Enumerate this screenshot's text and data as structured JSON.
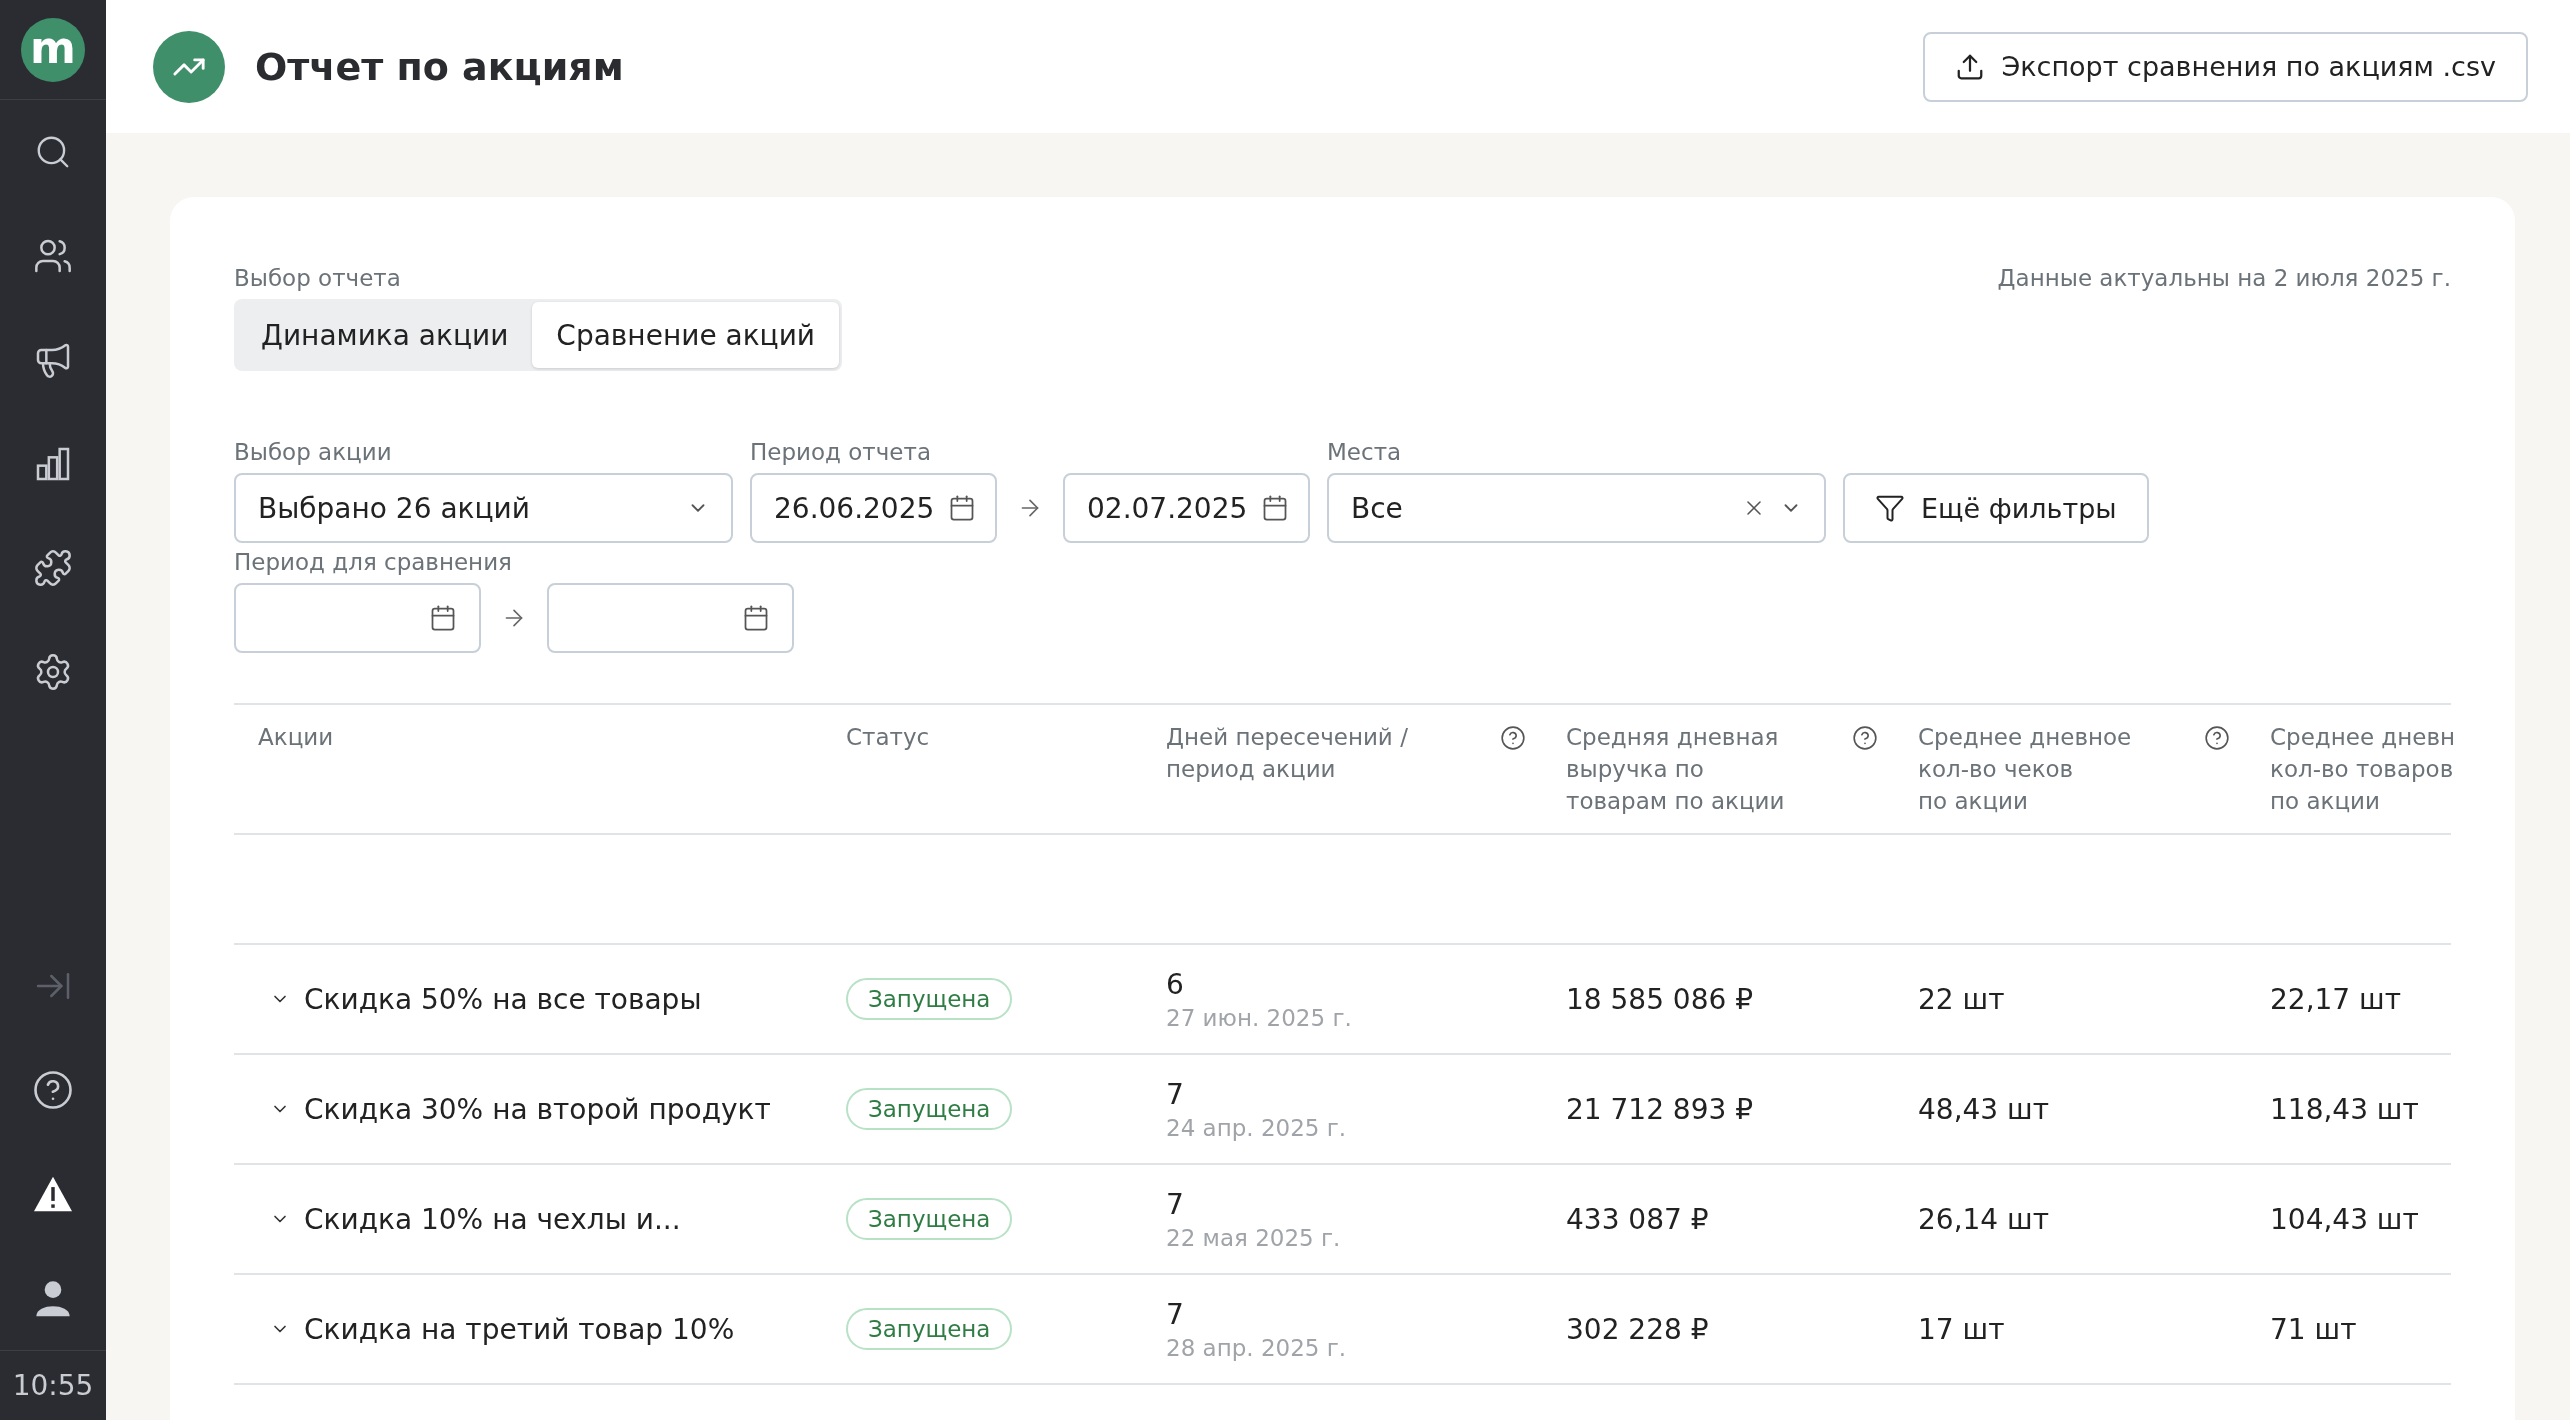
{
  "sidebar": {
    "logo": "m",
    "time": "10:55"
  },
  "header": {
    "title": "Отчет по акциям",
    "export_button": "Экспорт сравнения по акциям .csv"
  },
  "report_choice": {
    "label": "Выбор отчета",
    "tabs": [
      {
        "label": "Динамика акции",
        "selected": false
      },
      {
        "label": "Сравнение акций",
        "selected": true
      }
    ],
    "data_note": "Данные актуальны на 2 июля 2025 г."
  },
  "filters": {
    "promo": {
      "label": "Выбор акции",
      "value": "Выбрано 26 акций"
    },
    "period": {
      "label": "Период отчета",
      "from": "26.06.2025",
      "to": "02.07.2025"
    },
    "places": {
      "label": "Места",
      "value": "Все"
    },
    "more_button": "Ещё фильтры",
    "compare_period": {
      "label": "Период для сравнения"
    }
  },
  "table": {
    "columns": [
      {
        "lines": [
          "Акции"
        ],
        "help": false
      },
      {
        "lines": [
          "Статус"
        ],
        "help": false
      },
      {
        "lines": [
          "Дней пересечений /",
          "период акции"
        ],
        "help": true
      },
      {
        "lines": [
          "Средняя дневная",
          "выручка по",
          "товарам по акции"
        ],
        "help": true
      },
      {
        "lines": [
          "Среднее дневное",
          "кол-во чеков",
          "по акции"
        ],
        "help": true
      },
      {
        "lines": [
          "Среднее дневн",
          "кол-во товаров",
          "по акции"
        ]
      }
    ],
    "rows": [
      {
        "name": "Скидка 50% на все товары",
        "status": "Запущена",
        "days": "6",
        "date": "27 июн. 2025 г.",
        "revenue": "18 585 086 ₽",
        "checks": "22 шт",
        "items": "22,17 шт"
      },
      {
        "name": "Скидка 30% на второй продукт",
        "status": "Запущена",
        "days": "7",
        "date": "24 апр. 2025 г.",
        "revenue": "21 712 893 ₽",
        "checks": "48,43 шт",
        "items": "118,43 шт"
      },
      {
        "name": "Скидка 10% на чехлы и...",
        "status": "Запущена",
        "days": "7",
        "date": "22 мая 2025 г.",
        "revenue": "433 087 ₽",
        "checks": "26,14 шт",
        "items": "104,43 шт"
      },
      {
        "name": "Скидка на третий товар 10%",
        "status": "Запущена",
        "days": "7",
        "date": "28 апр. 2025 г.",
        "revenue": "302 228 ₽",
        "checks": "17 шт",
        "items": "71 шт"
      }
    ]
  }
}
